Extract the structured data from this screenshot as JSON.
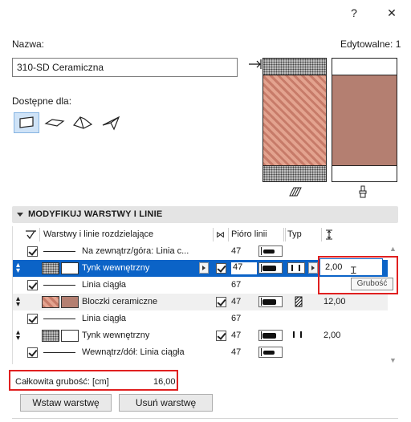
{
  "window": {
    "help_label": "?",
    "close_label": "✕"
  },
  "form": {
    "name_label": "Nazwa:",
    "name_value": "310-SD Ceramiczna",
    "editable_label": "Edytowalne: 1",
    "available_label": "Dostępne dla:"
  },
  "section": {
    "title": "MODYFIKUJ WARSTWY I LINIE"
  },
  "table": {
    "headers": {
      "name": "Warstwy i linie rozdzielające",
      "pen": "Pióro linii",
      "type": "Typ"
    },
    "rows": [
      {
        "label": "Na zewnątrz/góra: Linia c...",
        "pen": "47",
        "kind": "line"
      },
      {
        "label": "Tynk wewnętrzny",
        "pen": "47",
        "kind": "layer",
        "value": "2,00",
        "selected": true
      },
      {
        "label": "Linia ciągła",
        "pen": "67",
        "kind": "line"
      },
      {
        "label": "Bloczki ceramiczne",
        "pen": "47",
        "kind": "layer",
        "value": "12,00"
      },
      {
        "label": "Linia ciągła",
        "pen": "67",
        "kind": "line"
      },
      {
        "label": "Tynk wewnętrzny",
        "pen": "47",
        "kind": "layer",
        "value": "2,00"
      },
      {
        "label": "Wewnątrz/dół: Linia ciągła",
        "pen": "47",
        "kind": "line"
      }
    ],
    "edit_value": "2,00",
    "tooltip": "Grubość"
  },
  "total": {
    "label": "Całkowita grubość: [cm]",
    "value": "16,00"
  },
  "buttons": {
    "insert": "Wstaw warstwę",
    "delete": "Usuń warstwę"
  },
  "colors": {
    "selection": "#0b63c7",
    "brick": "#c77b69",
    "highlight": "#e02020",
    "section_bg": "#e4e4e4"
  }
}
